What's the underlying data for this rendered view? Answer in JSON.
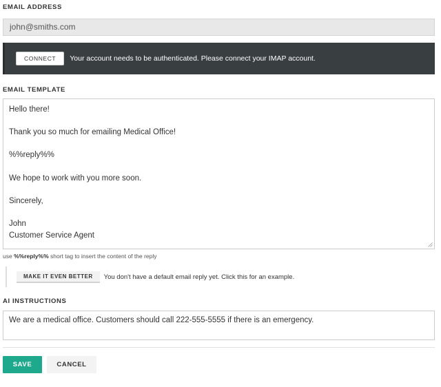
{
  "email_section": {
    "label": "EMAIL ADDRESS",
    "value": "john@smiths.com"
  },
  "auth_banner": {
    "button_label": "CONNECT",
    "message": "Your account needs to be authenticated. Please connect your IMAP account.",
    "background_color": "#393e41"
  },
  "template_section": {
    "label": "EMAIL TEMPLATE",
    "lines": [
      "Hello there!",
      "",
      "Thank you so much for emailing Medical Office!",
      "",
      "%%reply%%",
      "",
      "We hope to work with you more soon.",
      "",
      "Sincerely,",
      "",
      "John",
      "Customer Service Agent"
    ],
    "hint_prefix": "use ",
    "hint_tag": "%%reply%%",
    "hint_suffix": " short tag to insert the content of the reply"
  },
  "improve": {
    "button_label": "MAKE IT EVEN BETTER",
    "message": "You don't have a default email reply yet. Click this for an example."
  },
  "ai_section": {
    "label": "AI INSTRUCTIONS",
    "value": "We are a medical office. Customers should call 222-555-5555 if there is an emergency."
  },
  "actions": {
    "save_label": "SAVE",
    "cancel_label": "CANCEL",
    "save_color": "#1fa98c"
  },
  "icons": {
    "resize": "resize-grip-icon"
  }
}
